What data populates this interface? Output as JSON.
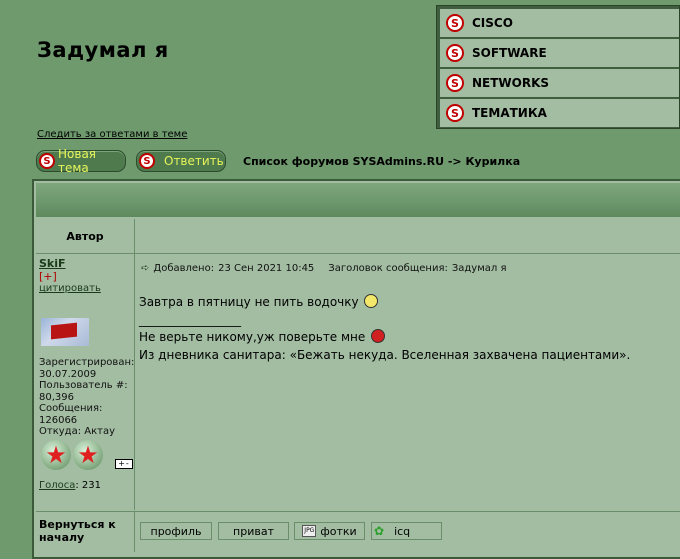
{
  "page": {
    "title": "Задумал я",
    "watch_link": "Следить за ответами в теме",
    "forum_path": "Список форумов SYSAdmins.RU -> Курилка"
  },
  "top_menu": {
    "items": [
      {
        "label": "CISCO",
        "icon": "s-logo-icon"
      },
      {
        "label": "SOFTWARE",
        "icon": "s-logo-icon"
      },
      {
        "label": "NETWORKS",
        "icon": "s-logo-icon"
      },
      {
        "label": "ТЕМАТИКА",
        "icon": "s-logo-icon"
      }
    ]
  },
  "actions": {
    "new_topic": "Новая тема",
    "reply": "Ответить"
  },
  "table": {
    "author_header": "Автор"
  },
  "post": {
    "author": {
      "name": "SkiF",
      "plus": "[+]",
      "quote": "цитировать",
      "registered_label": "Зарегистрирован:",
      "registered_date": "30.07.2009",
      "user_no_label": "Пользователь #:",
      "user_no": "80,396",
      "messages_label": "Сообщения:",
      "messages": "126066",
      "from_label": "Откуда:",
      "from": "Актау",
      "votes_label": "Голоса",
      "votes": "231",
      "expand_glyph": "+-"
    },
    "meta": {
      "added_label": "Добавлено:",
      "added_date": "23 Сен 2021 10:45",
      "subject_label": "Заголовок сообщения:",
      "subject": "Задумал я"
    },
    "body": {
      "line1": "Завтра в пятницу не пить водочку",
      "separator": "_________________",
      "line2": "Не верьте никому,уж поверьте мне",
      "line3": "Из дневника санитара: «Бежать некуда. Вселенная захвачена пациентами»."
    }
  },
  "footer": {
    "back_to_top": "Вернуться к началу",
    "buttons": {
      "profile": "профиль",
      "private": "приват",
      "photos": "фотки",
      "icq": "icq"
    }
  },
  "colors": {
    "page_bg": "#6e9a6e",
    "panel_bg": "#a3bda3",
    "menu_frame": "#3e5e3e",
    "button_text": "#e8f55a",
    "logo_red": "#c00000"
  }
}
